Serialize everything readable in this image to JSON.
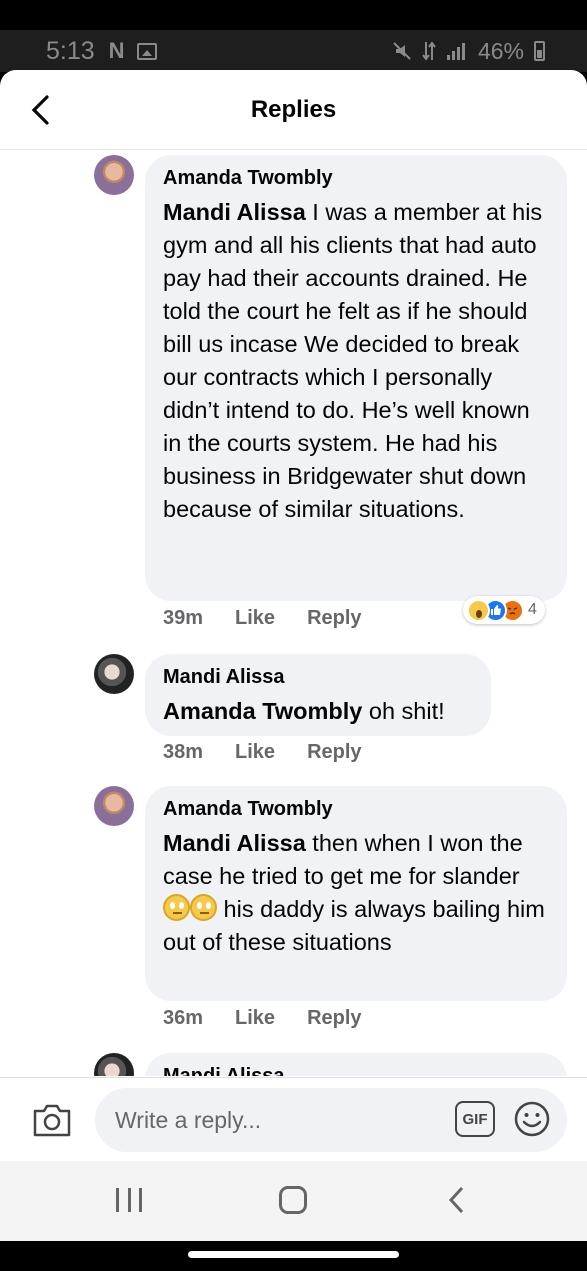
{
  "status_bar": {
    "time": "5:13",
    "notification_letter": "N",
    "battery": "46%"
  },
  "header": {
    "title": "Replies",
    "back_icon": "chevron-left-icon"
  },
  "comments": [
    {
      "author": "Amanda Twombly",
      "mention": "Mandi Alissa",
      "text": " I was a member at his gym and all his clients that had auto pay had their accounts drained. He told the court he felt as if he should bill us incase We decided to break our contracts which I personally didn’t intend to do. He’s well known in the courts system. He had his business in Bridgewater shut down because of similar situations.",
      "time": "39m",
      "like_label": "Like",
      "reply_label": "Reply",
      "reactions": {
        "icons": [
          "wow-reaction-icon",
          "like-reaction-icon",
          "angry-reaction-icon"
        ],
        "count": "4"
      }
    },
    {
      "author": "Mandi Alissa",
      "mention": "Amanda Twombly",
      "text": " oh shit!",
      "time": "38m",
      "like_label": "Like",
      "reply_label": "Reply"
    },
    {
      "author": "Amanda Twombly",
      "mention": "Mandi Alissa",
      "text_before_emoji": " then when I won the case he tried to get me for slander ",
      "emojis": [
        "eye-roll-emoji-icon",
        "eye-roll-emoji-icon"
      ],
      "text_after_emoji": " his daddy is always bailing him out of these situations",
      "time": "36m",
      "like_label": "Like",
      "reply_label": "Reply"
    },
    {
      "author": "Mandi Alissa"
    }
  ],
  "composer": {
    "placeholder": "Write a reply...",
    "gif_label": "GIF"
  },
  "colors": {
    "bubble": "#f0f2f5",
    "meta_text": "#65676b",
    "like_blue": "#1877f2"
  }
}
